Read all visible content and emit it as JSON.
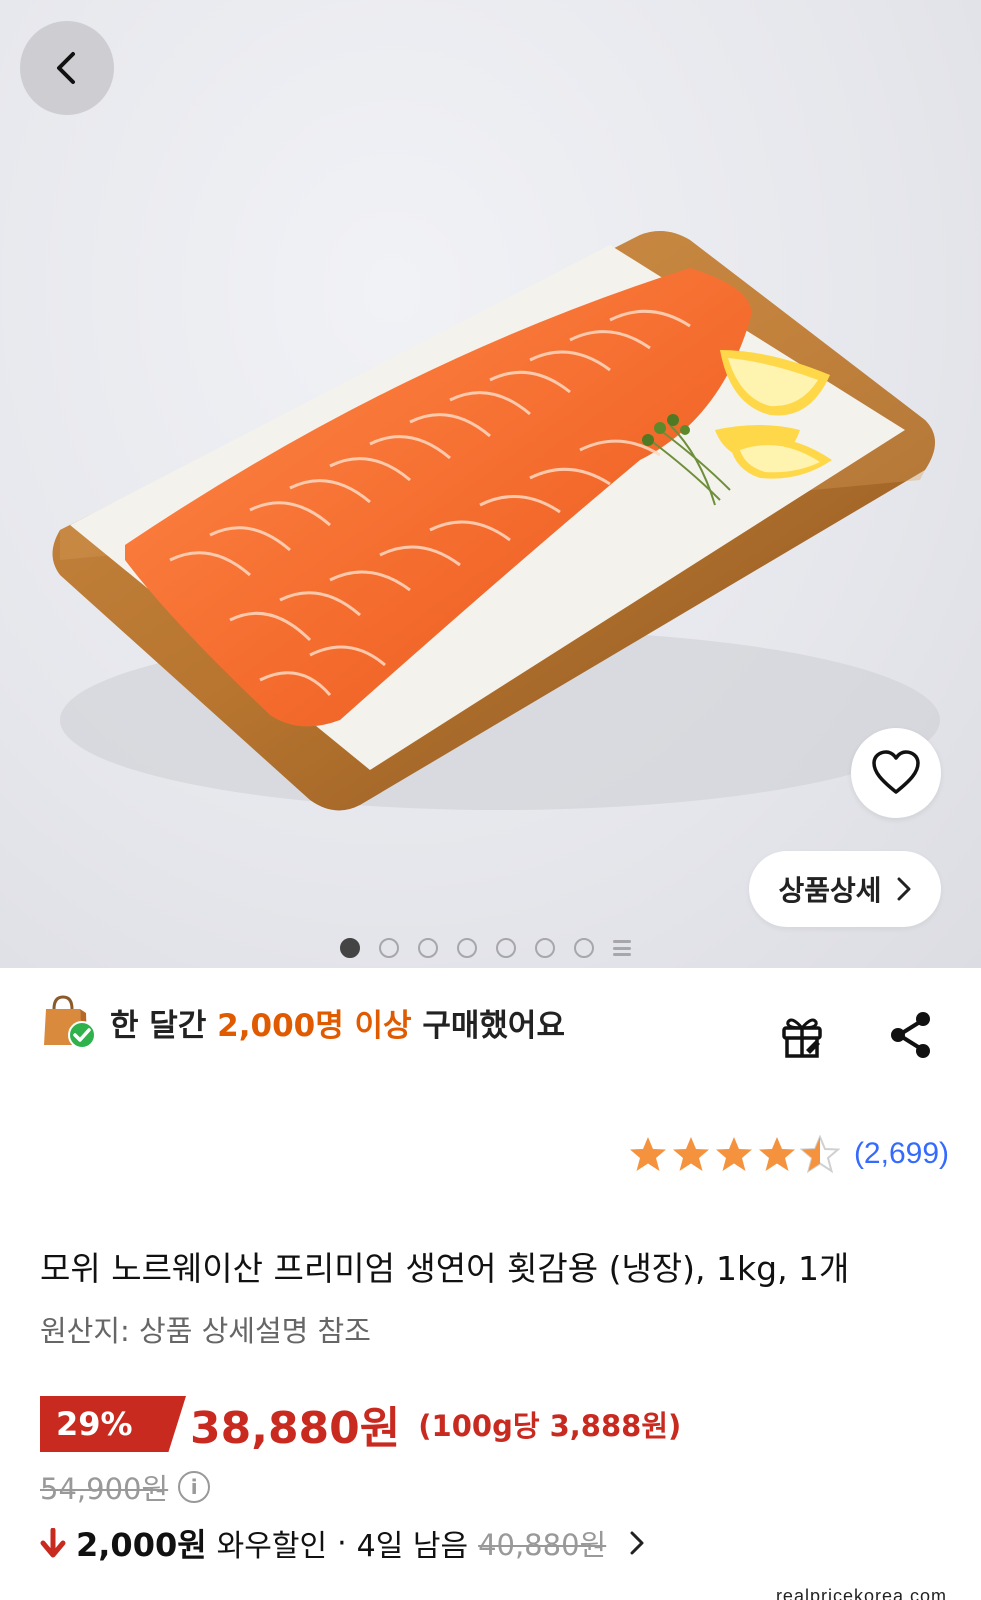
{
  "gallery": {
    "total_images": 8,
    "active_index": 0,
    "detail_button_label": "상품상세",
    "image_subject": "salmon fillet on wooden cutting board with lemon wedges"
  },
  "icons": {
    "back": "chevron-left-icon",
    "favorite": "heart-outline-icon",
    "detail_arrow": "chevron-right-icon",
    "social_badge": "shopping-bag-check-icon",
    "gift": "gift-icon",
    "share": "share-icon",
    "info": "info-icon",
    "down_arrow": "arrow-down-icon",
    "wow_arrow": "chevron-right-icon"
  },
  "social_proof": {
    "prefix": "한 달간 ",
    "highlight": "2,000명 이상",
    "suffix": " 구매했어요"
  },
  "rating": {
    "value": 4.5,
    "max": 5,
    "count_label": "(2,699)"
  },
  "product": {
    "title": "모위 노르웨이산 프리미엄 생연어 횟감용 (냉장), 1kg, 1개",
    "origin": "원산지: 상품 상세설명 참조"
  },
  "price": {
    "discount_rate": "29%",
    "sale_price": "38,880원",
    "unit_price": "(100g당 3,888원)",
    "original_price": "54,900원",
    "info_icon_glyph": "i"
  },
  "wow": {
    "amount": "2,000원",
    "label": "와우할인",
    "separator": "·",
    "remaining": "4일 남음",
    "strike_price": "40,880원"
  },
  "watermark": "realpricekorea.com",
  "colors": {
    "accent_red": "#c92a20",
    "highlight_orange": "#e05a00",
    "star_orange": "#f5923e",
    "link_blue": "#346aff"
  }
}
